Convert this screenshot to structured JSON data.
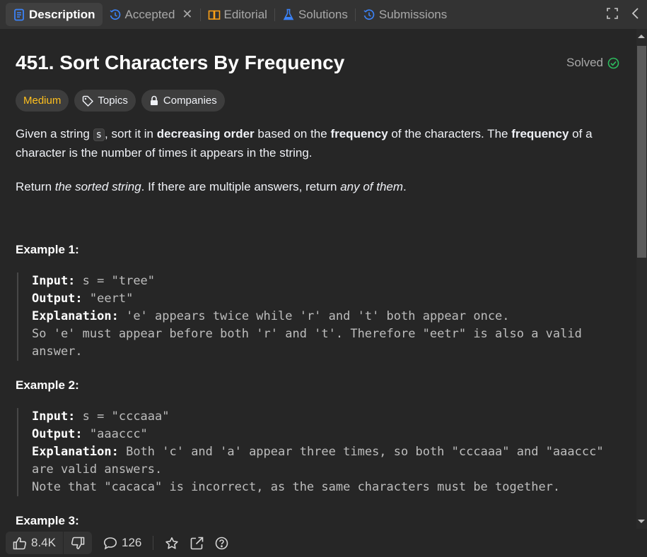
{
  "tabs": [
    {
      "label": "Description",
      "icon": "description-icon",
      "active": true
    },
    {
      "label": "Accepted",
      "icon": "history-icon",
      "closable": true
    },
    {
      "label": "Editorial",
      "icon": "book-icon"
    },
    {
      "label": "Solutions",
      "icon": "flask-icon"
    },
    {
      "label": "Submissions",
      "icon": "history-icon"
    }
  ],
  "problem": {
    "title": "451. Sort Characters By Frequency",
    "status": "Solved",
    "difficulty": "Medium",
    "topics_label": "Topics",
    "companies_label": "Companies"
  },
  "description": {
    "p1_a": "Given a string ",
    "p1_code": "s",
    "p1_b": ", sort it in ",
    "p1_bold1": "decreasing order",
    "p1_c": " based on the ",
    "p1_bold2": "frequency",
    "p1_d": " of the characters. The ",
    "p1_bold3": "frequency",
    "p1_e": " of a character is the number of times it appears in the string.",
    "p2_a": "Return ",
    "p2_em1": "the sorted string",
    "p2_b": ". If there are multiple answers, return ",
    "p2_em2": "any of them",
    "p2_c": "."
  },
  "examples": [
    {
      "title": "Example 1:",
      "input_label": "Input:",
      "input": "s = \"tree\"",
      "output_label": "Output:",
      "output": "\"eert\"",
      "explanation_label": "Explanation:",
      "explanation_1": "'e' appears twice while 'r' and 't' both appear once.",
      "explanation_2": "So 'e' must appear before both 'r' and 't'. Therefore \"eetr\" is also a valid",
      "explanation_3": "answer."
    },
    {
      "title": "Example 2:",
      "input_label": "Input:",
      "input": "s = \"cccaaa\"",
      "output_label": "Output:",
      "output": "\"aaaccc\"",
      "explanation_label": "Explanation:",
      "explanation_1": "Both 'c' and 'a' appear three times, so both \"cccaaa\" and \"aaaccc\"",
      "explanation_2": "are valid answers.",
      "explanation_3": "Note that \"cacaca\" is incorrect, as the same characters must be together."
    },
    {
      "title": "Example 3:"
    }
  ],
  "bottom": {
    "likes": "8.4K",
    "comments": "126"
  },
  "colors": {
    "medium": "#ffc01e",
    "solved_check": "#2cbb5d",
    "tab_icon_blue": "#3b82f6",
    "book_icon": "#ffa116"
  }
}
